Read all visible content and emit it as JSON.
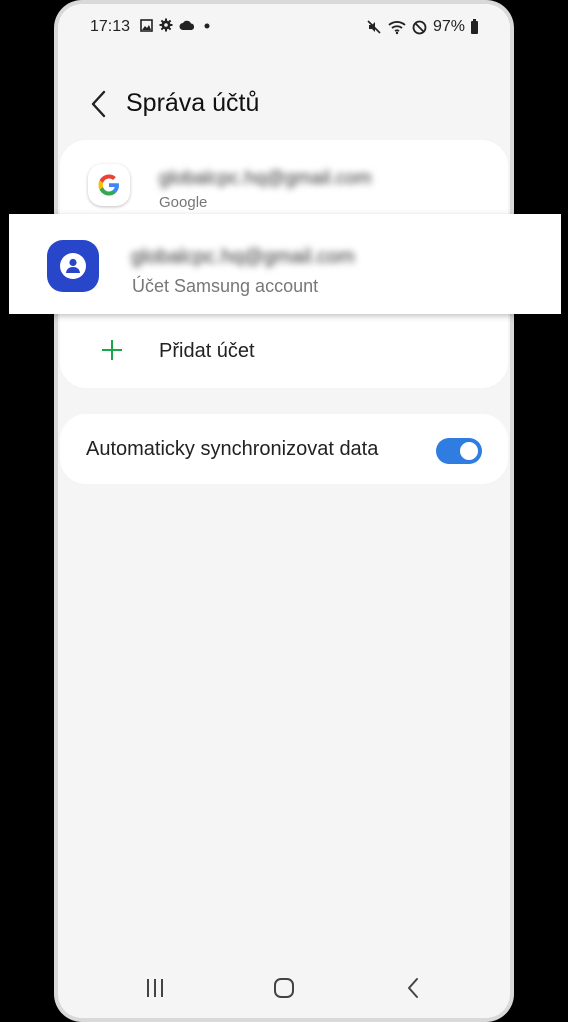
{
  "status_bar": {
    "time": "17:13",
    "battery": "97%",
    "left_icons": [
      "image-icon",
      "gear-icon",
      "cloud-icon",
      "dot-icon"
    ],
    "right_icons": [
      "mute-vibrate-icon",
      "wifi-icon",
      "do-not-disturb-icon",
      "battery-icon"
    ]
  },
  "header": {
    "title": "Správa účtů",
    "back_icon": "chevron-left-icon"
  },
  "accounts": [
    {
      "email": "globalcpc.hq@gmail.com",
      "type": "Google",
      "icon": "google-icon"
    },
    {
      "email": "globalcpc.hq@gmail.com",
      "type": "Účet Samsung account",
      "icon": "samsung-account-icon",
      "highlighted": true
    }
  ],
  "add_account": {
    "label": "Přidat účet",
    "icon": "plus-icon",
    "icon_color": "#1aa74a"
  },
  "sync": {
    "label": "Automaticky synchronizovat data",
    "enabled": true,
    "accent_color": "#2f7de1"
  },
  "nav_bar": {
    "icons": [
      "recents-icon",
      "home-icon",
      "back-icon"
    ]
  }
}
